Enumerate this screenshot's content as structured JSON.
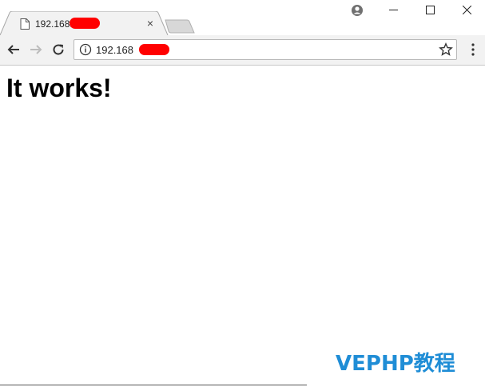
{
  "tab": {
    "title": "192.168.",
    "favicon": "page-icon",
    "close_label": "×"
  },
  "window_controls": {
    "minimize": "—",
    "maximize": "☐",
    "close": "✕"
  },
  "toolbar": {
    "url": "192.168",
    "back_icon": "back-arrow-icon",
    "forward_icon": "forward-arrow-icon",
    "reload_icon": "reload-icon",
    "info_icon": "info-icon",
    "bookmark_icon": "star-icon",
    "menu_icon": "kebab-menu-icon"
  },
  "page": {
    "heading": "It works!",
    "watermark": "VEPHP教程"
  },
  "colors": {
    "redaction": "#ff0000",
    "watermark": "#1f8dd6",
    "toolbar_bg": "#f2f2f2"
  }
}
